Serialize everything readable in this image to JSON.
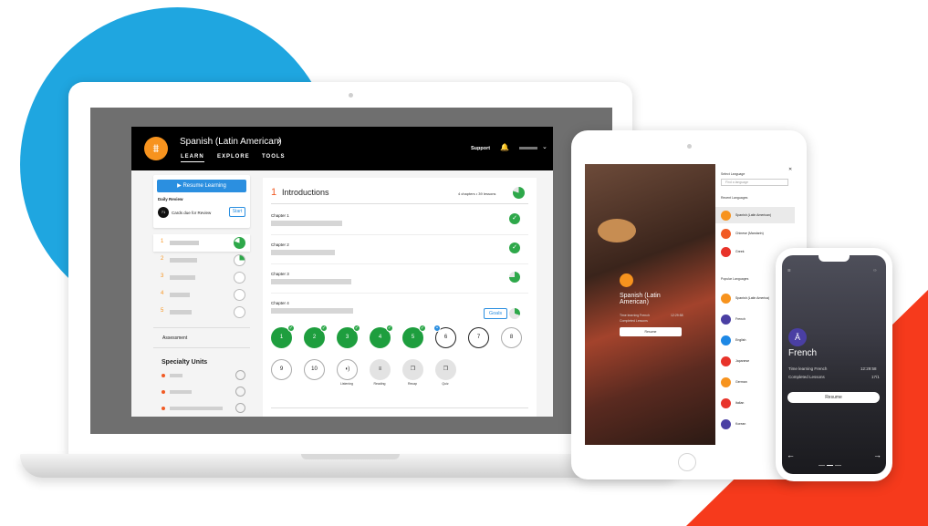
{
  "colors": {
    "blue_circle": "#1fa6e0",
    "red_accent": "#f63a1c",
    "brand_orange": "#f7931e",
    "progress_green": "#2ea84a",
    "link_blue": "#2b8fe0"
  },
  "laptop": {
    "header": {
      "logo_icon": "language-pillar-icon",
      "course_title": "Spanish (Latin American)",
      "chevron": "›",
      "nav": {
        "learn": "LEARN",
        "explore": "EXPLORE",
        "tools": "TOOLS"
      },
      "support": "Support",
      "bell_icon": "bell-icon"
    },
    "sidebar": {
      "resume_label": "Resume Learning",
      "daily_review": "Daily Review",
      "cards_count": "71",
      "cards_text": "Cards due for Review",
      "start": "Start",
      "units": [
        {
          "num": "1",
          "progress": 0.8
        },
        {
          "num": "2",
          "progress": 0.25
        },
        {
          "num": "3",
          "progress": 0
        },
        {
          "num": "4",
          "progress": 0
        },
        {
          "num": "5",
          "progress": 0
        }
      ],
      "assessment": "Assessment",
      "specialty": "Specialty Units"
    },
    "main": {
      "unit_num": "1",
      "unit_title": "Introductions",
      "unit_meta": "4 chapters • 39 lessons",
      "chapters": [
        {
          "label": "Chapter 1",
          "state": "complete"
        },
        {
          "label": "Chapter 2",
          "state": "complete"
        },
        {
          "label": "Chapter 3",
          "state": "partial",
          "progress": 0.75
        },
        {
          "label": "Chapter 4",
          "state": "partial",
          "progress": 0.3
        }
      ],
      "goals": "Goals",
      "lessons_row1": [
        "1",
        "2",
        "3",
        "4",
        "5",
        "6",
        "7",
        "8"
      ],
      "lessons_row2": [
        "9",
        "10"
      ],
      "activities": [
        "Listening",
        "Reading",
        "Recap",
        "Quiz"
      ]
    }
  },
  "tablet": {
    "language": "Spanish (Latin American)",
    "panel": {
      "select_label": "Select Language",
      "search_placeholder": "Find a language",
      "recent_label": "Recent Languages",
      "recent": [
        {
          "name": "Spanish (Latin American)",
          "color": "#f7931e"
        },
        {
          "name": "Chinese (Mandarin)",
          "color": "#f15a24"
        },
        {
          "name": "Greek",
          "color": "#e8332a"
        }
      ],
      "popular_label": "Popular Languages",
      "popular": [
        {
          "name": "Spanish (Latin America)",
          "color": "#f7931e"
        },
        {
          "name": "French",
          "color": "#4a3fa3"
        },
        {
          "name": "English",
          "color": "#1e88e5"
        },
        {
          "name": "Japanese",
          "color": "#e8332a"
        },
        {
          "name": "German",
          "color": "#f7931e"
        },
        {
          "name": "Italian",
          "color": "#e8332a"
        },
        {
          "name": "Korean",
          "color": "#4a3fa3"
        }
      ]
    }
  },
  "phone": {
    "language": "French",
    "stats": [
      {
        "label": "Time learning French",
        "value": "12:29:58"
      },
      {
        "label": "Completed Lessons",
        "value": "17/1"
      }
    ],
    "resume": "Resume"
  }
}
